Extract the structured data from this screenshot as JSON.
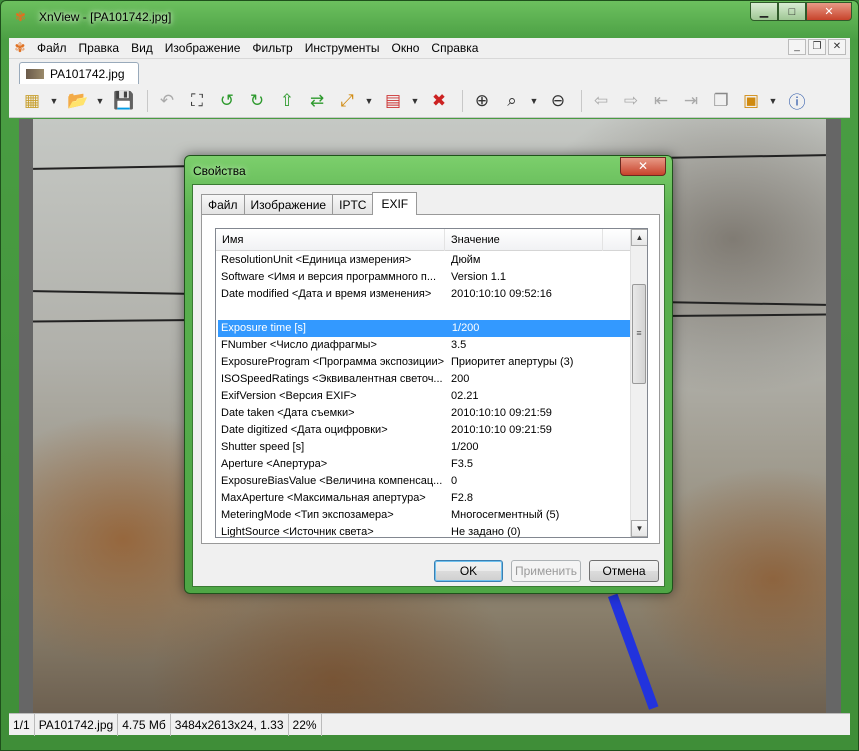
{
  "window": {
    "title": "XnView - [PA101742.jpg]",
    "minimize_label": "▁",
    "maximize_label": "□",
    "close_label": "✕"
  },
  "menubar": {
    "items": [
      "Файл",
      "Правка",
      "Вид",
      "Изображение",
      "Фильтр",
      "Инструменты",
      "Окно",
      "Справка"
    ]
  },
  "document_tab": {
    "label": "PA101742.jpg"
  },
  "statusbar": {
    "index": "1/1",
    "filename": "PA101742.jpg",
    "size": "4.75 Мб",
    "dimensions": "3484x2613x24, 1.33",
    "zoom": "22%"
  },
  "dialog": {
    "title": "Свойства",
    "close_label": "✕",
    "tabs": [
      "Файл",
      "Изображение",
      "IPTC",
      "EXIF"
    ],
    "active_tab": "EXIF",
    "columns": {
      "name": "Имя",
      "value": "Значение"
    },
    "rows": [
      {
        "name": "ResolutionUnit <Единица измерения>",
        "value": "Дюйм"
      },
      {
        "name": "Software <Имя и версия программного п...",
        "value": "Version 1.1"
      },
      {
        "name": "Date modified <Дата и время изменения>",
        "value": "2010:10:10 09:52:16"
      },
      {
        "name": "",
        "value": ""
      },
      {
        "name": "Exposure time [s]",
        "value": "1/200",
        "selected": true
      },
      {
        "name": "FNumber <Число диафрагмы>",
        "value": "3.5"
      },
      {
        "name": "ExposureProgram <Программа экспозиции>",
        "value": "Приоритет апертуры (3)"
      },
      {
        "name": "ISOSpeedRatings <Эквивалентная светоч...",
        "value": "200"
      },
      {
        "name": "ExifVersion <Версия EXIF>",
        "value": "02.21"
      },
      {
        "name": "Date taken <Дата съемки>",
        "value": "2010:10:10 09:21:59"
      },
      {
        "name": "Date digitized <Дата оцифровки>",
        "value": "2010:10:10 09:21:59"
      },
      {
        "name": "Shutter speed [s]",
        "value": "1/200"
      },
      {
        "name": "Aperture <Апертура>",
        "value": "F3.5"
      },
      {
        "name": "ExposureBiasValue <Величина компенсац...",
        "value": "0"
      },
      {
        "name": "MaxAperture <Максимальная апертура>",
        "value": "F2.8"
      },
      {
        "name": "MeteringMode <Тип экспозамера>",
        "value": "Многосегментный (5)"
      },
      {
        "name": "LightSource <Источник света>",
        "value": "Не задано (0)"
      }
    ],
    "buttons": {
      "ok": "OK",
      "apply": "Применить",
      "cancel": "Отмена"
    }
  },
  "toolbar_icons": [
    "browser-icon",
    "open-folder-icon",
    "save-icon",
    "undo-icon",
    "crop-icon",
    "rotate-left-icon",
    "rotate-right-icon",
    "up-icon",
    "convert-icon",
    "resize-icon",
    "adjust-icon",
    "delete-icon",
    "zoom-in-icon",
    "zoom-icon",
    "zoom-out-icon",
    "prev-icon",
    "next-icon",
    "first-icon",
    "last-icon",
    "slideshow-icon",
    "wallpaper-icon",
    "info-icon"
  ]
}
